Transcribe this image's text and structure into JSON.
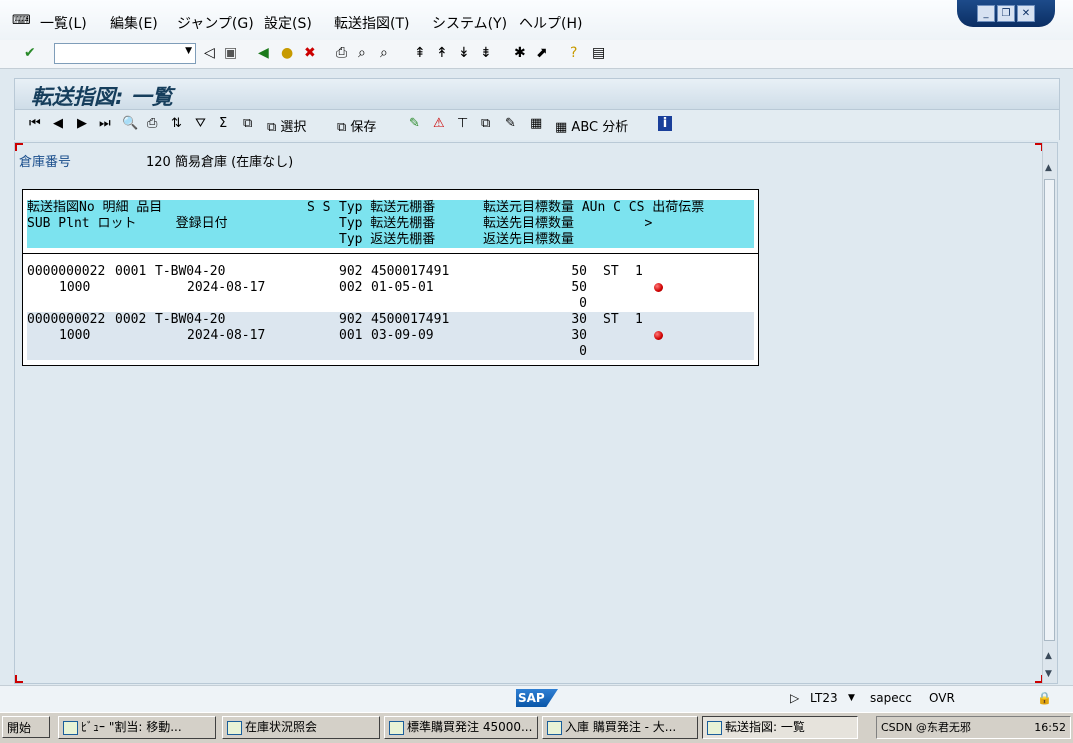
{
  "menu": {
    "items": [
      "一覧(L)",
      "編集(E)",
      "ジャンプ(G)",
      "設定(S)",
      "転送指図(T)",
      "システム(Y)",
      "ヘルプ(H)"
    ]
  },
  "screen": {
    "title": "転送指図: 一覧"
  },
  "app_toolbar": {
    "select_label": "選択",
    "save_label": "保存",
    "abc_label": "ABC 分析"
  },
  "header": {
    "warehouse_label": "倉庫番号",
    "warehouse_value": "120 簡易倉庫 (在庫なし)"
  },
  "list": {
    "header_rows": [
      {
        "c1": "転送指図No 明細 品目",
        "c2": "S S",
        "c3": "Typ 転送元棚番",
        "c4": "転送元目標数量 AUn C CS 出荷伝票"
      },
      {
        "c1": "SUB Plnt ロット     登録日付",
        "c2": "",
        "c3": "Typ 転送先棚番",
        "c4": "転送先目標数量         >"
      },
      {
        "c1": "",
        "c2": "",
        "c3": "Typ 返送先棚番",
        "c4": "返送先目標数量"
      }
    ],
    "items": [
      {
        "to_no": "0000000022",
        "item": "0001",
        "material": "T-BW04-20",
        "src_type": "902",
        "src_bin": "4500017491",
        "src_qty": "50",
        "uom": "ST",
        "c": "1",
        "plant": "1000",
        "created": "2024-08-17",
        "dst_type": "002",
        "dst_bin": "01-05-01",
        "dst_qty": "50",
        "ret_qty": "0",
        "status_color": "#d00000"
      },
      {
        "to_no": "0000000022",
        "item": "0002",
        "material": "T-BW04-20",
        "src_type": "902",
        "src_bin": "4500017491",
        "src_qty": "30",
        "uom": "ST",
        "c": "1",
        "plant": "1000",
        "created": "2024-08-17",
        "dst_type": "001",
        "dst_bin": "03-09-09",
        "dst_qty": "30",
        "ret_qty": "0",
        "status_color": "#d00000"
      }
    ]
  },
  "status": {
    "brand": "SAP",
    "transaction": "LT23",
    "system": "sapecc",
    "mode": "OVR"
  },
  "taskbar": {
    "start": "開始",
    "tasks": [
      "ﾋﾞｭｰ \"割当: 移動...",
      "在庫状況照会",
      "標準購買発注 45000...",
      "入庫 購買発注 - 大...",
      "転送指図: 一覧"
    ],
    "tray_text": "CSDN @东君无邪",
    "clock": "16:52"
  }
}
